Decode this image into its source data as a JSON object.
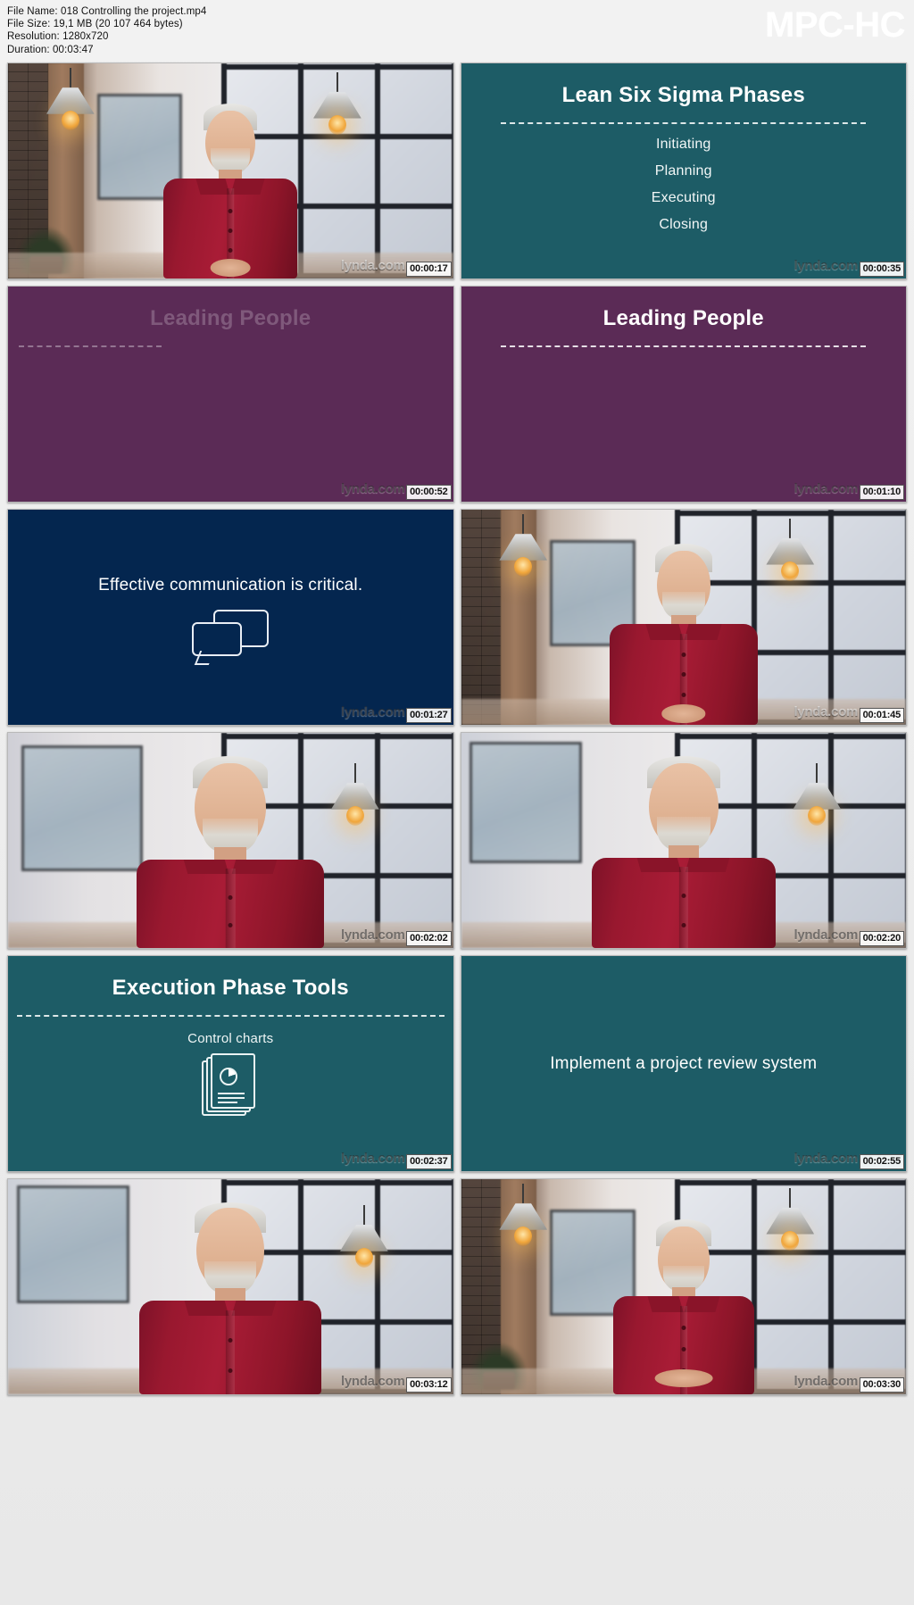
{
  "player": {
    "brand": "MPC-HC"
  },
  "file_info": {
    "file_name_label": "File Name: 018 Controlling the project.mp4",
    "file_size_label": "File Size: 19,1 MB (20 107 464 bytes)",
    "resolution_label": "Resolution: 1280x720",
    "duration_label": "Duration: 00:03:47"
  },
  "watermark": "lynda.com",
  "thumbnails": [
    {
      "index": 1,
      "timestamp": "00:00:17",
      "kind": "video",
      "watermark_dark": false
    },
    {
      "index": 2,
      "timestamp": "00:00:35",
      "kind": "slide",
      "theme": "teal",
      "theme_color": "#1d5c66",
      "title": "Lean Six Sigma Phases",
      "bullets": [
        "Initiating",
        "Planning",
        "Executing",
        "Closing"
      ],
      "watermark_dark": true
    },
    {
      "index": 3,
      "timestamp": "00:00:52",
      "kind": "slide",
      "theme": "purple",
      "theme_color": "#5b2b56",
      "title": "Leading People",
      "faded": true,
      "watermark_dark": true
    },
    {
      "index": 4,
      "timestamp": "00:01:10",
      "kind": "slide",
      "theme": "purple",
      "theme_color": "#5b2b56",
      "title": "Leading People",
      "faded": false,
      "watermark_dark": true
    },
    {
      "index": 5,
      "timestamp": "00:01:27",
      "kind": "slide",
      "theme": "navy",
      "theme_color": "#04264f",
      "headline": "Effective communication is critical.",
      "icon": "speech-bubbles-icon",
      "watermark_dark": true
    },
    {
      "index": 6,
      "timestamp": "00:01:45",
      "kind": "video",
      "watermark_dark": false
    },
    {
      "index": 7,
      "timestamp": "00:02:02",
      "kind": "video",
      "watermark_dark": true
    },
    {
      "index": 8,
      "timestamp": "00:02:20",
      "kind": "video",
      "watermark_dark": true
    },
    {
      "index": 9,
      "timestamp": "00:02:37",
      "kind": "slide",
      "theme": "teal",
      "theme_color": "#1d5c66",
      "title": "Execution Phase Tools",
      "subtitle": "Control charts",
      "icon": "documents-chart-icon",
      "watermark_dark": true
    },
    {
      "index": 10,
      "timestamp": "00:02:55",
      "kind": "slide",
      "theme": "teal",
      "theme_color": "#1d5c66",
      "headline": "Implement a project review system",
      "watermark_dark": true
    },
    {
      "index": 11,
      "timestamp": "00:03:12",
      "kind": "video",
      "watermark_dark": true
    },
    {
      "index": 12,
      "timestamp": "00:03:30",
      "kind": "video",
      "watermark_dark": true
    }
  ]
}
